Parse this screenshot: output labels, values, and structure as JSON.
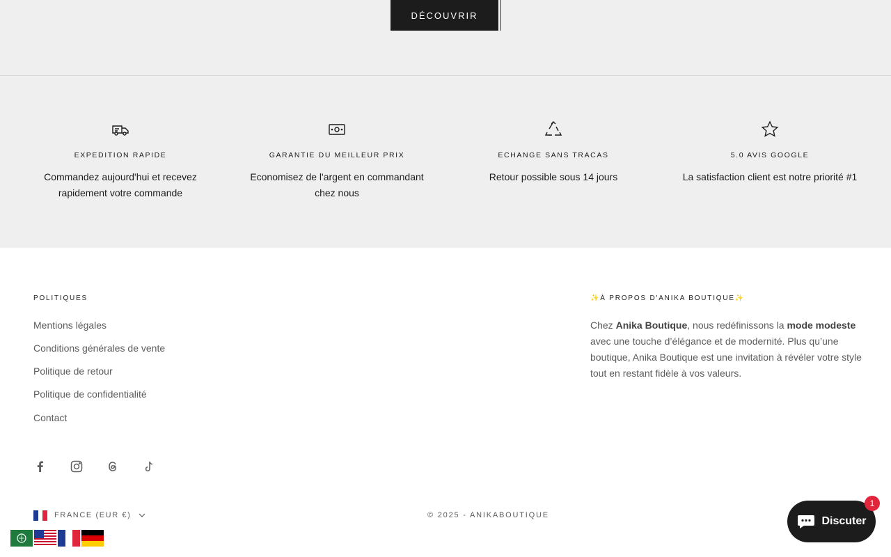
{
  "hero": {
    "discover_label": "DÉCOUVRIR"
  },
  "features": [
    {
      "icon": "truck-icon",
      "title": "EXPEDITION RAPIDE",
      "desc1": "Commandez aujourd'hui et recevez",
      "desc2": "rapidement votre commande"
    },
    {
      "icon": "banknote-icon",
      "title": "GARANTIE DU MEILLEUR PRIX",
      "desc1": "Economisez de l'argent en commandant",
      "desc2": "chez nous"
    },
    {
      "icon": "recycle-icon",
      "title": "ECHANGE SANS TRACAS",
      "desc1": "Retour possible sous 14 jours",
      "desc2": ""
    },
    {
      "icon": "star-icon",
      "title": "5.0 AVIS GOOGLE",
      "desc1": "La satisfaction client est notre priorité #1",
      "desc2": ""
    }
  ],
  "footer": {
    "policies_title": "POLITIQUES",
    "policies": [
      "Mentions légales",
      "Conditions générales de vente",
      "Politique de retour",
      "Politique de confidentialité",
      "Contact"
    ],
    "about_title": "✨À PROPOS D'ANIKA BOUTIQUE✨",
    "about": {
      "p1": "Chez ",
      "b1": "Anika Boutique",
      "p2": ", nous redéfinissons la ",
      "b2": "mode modeste",
      "p3": " avec une touche d’élégance et de modernité. Plus qu’une boutique, Anika Boutique est une invitation à révéler votre style tout en restant fidèle à vos valeurs."
    },
    "social_icons": [
      "facebook-icon",
      "instagram-icon",
      "threads-icon",
      "tiktok-icon"
    ],
    "country_label": "FRANCE (EUR €)",
    "copyright": "© 2025 - ANIKABOUTIQUE"
  },
  "chat": {
    "label": "Discuter",
    "badge": "1"
  },
  "colors": {
    "dark": "#1c1c1c",
    "light_bg": "#efefef",
    "badge": "#e0263c"
  }
}
